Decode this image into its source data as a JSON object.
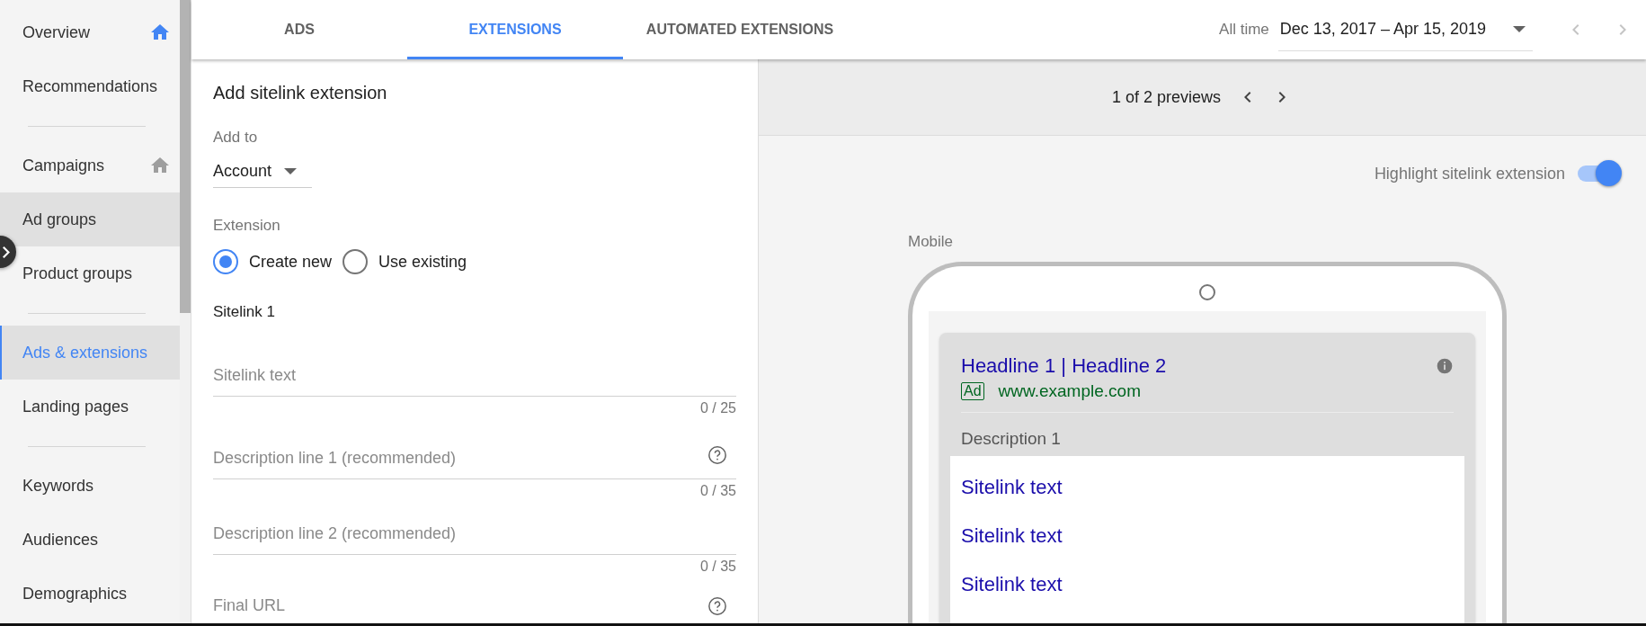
{
  "sidebar": {
    "groups": [
      {
        "items": [
          {
            "label": "Overview",
            "selected": false,
            "highlighted": false,
            "icon_active": true
          },
          {
            "label": "Recommendations",
            "selected": false,
            "highlighted": false
          }
        ]
      },
      {
        "items": [
          {
            "label": "Campaigns",
            "selected": false,
            "highlighted": false,
            "icon_active": false
          },
          {
            "label": "Ad groups",
            "selected": false,
            "highlighted": true
          },
          {
            "label": "Product groups",
            "selected": false,
            "highlighted": false
          }
        ]
      },
      {
        "items": [
          {
            "label": "Ads & extensions",
            "selected": true,
            "highlighted": false
          },
          {
            "label": "Landing pages",
            "selected": false,
            "highlighted": false
          }
        ]
      },
      {
        "items": [
          {
            "label": "Keywords",
            "selected": false,
            "highlighted": false
          },
          {
            "label": "Audiences",
            "selected": false,
            "highlighted": false
          },
          {
            "label": "Demographics",
            "selected": false,
            "highlighted": false
          }
        ]
      }
    ]
  },
  "tabs": [
    {
      "label": "ADS",
      "selected": false
    },
    {
      "label": "EXTENSIONS",
      "selected": true
    },
    {
      "label": "AUTOMATED EXTENSIONS",
      "selected": false
    }
  ],
  "date_range": {
    "label": "All time",
    "value": "Dec 13, 2017 – Apr 15, 2019"
  },
  "form": {
    "title": "Add sitelink extension",
    "add_to": {
      "label": "Add to",
      "value": "Account"
    },
    "extension": {
      "label": "Extension",
      "options": [
        {
          "label": "Create new",
          "selected": true
        },
        {
          "label": "Use existing",
          "selected": false
        }
      ]
    },
    "section": "Sitelink 1",
    "fields": [
      {
        "placeholder": "Sitelink text",
        "counter": "0 / 25",
        "help": false
      },
      {
        "placeholder": "Description line 1 (recommended)",
        "counter": "0 / 35",
        "help": true
      },
      {
        "placeholder": "Description line 2 (recommended)",
        "counter": "0 / 35",
        "help": false
      },
      {
        "placeholder": "Final URL",
        "help": true
      }
    ]
  },
  "preview": {
    "pager": "1 of 2 previews",
    "highlight": {
      "label": "Highlight sitelink extension",
      "on": true
    },
    "device": "Mobile",
    "ad": {
      "headline": "Headline 1 | Headline 2",
      "badge": "Ad",
      "url": "www.example.com",
      "description": "Description 1",
      "sitelinks": [
        "Sitelink text",
        "Sitelink text",
        "Sitelink text"
      ]
    }
  }
}
